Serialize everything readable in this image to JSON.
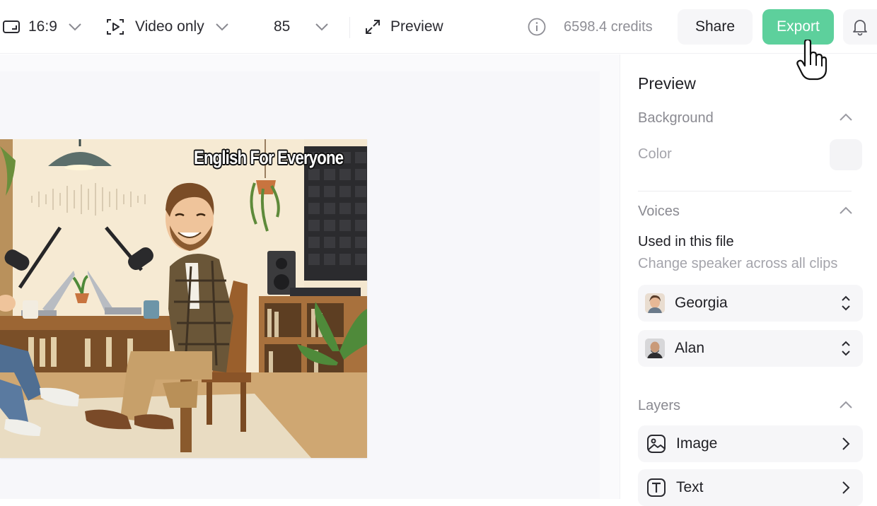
{
  "toolbar": {
    "aspect_ratio": "16:9",
    "media_mode": "Video only",
    "zoom": "85",
    "preview_label": "Preview",
    "credits": "6598.4 credits",
    "share_label": "Share",
    "export_label": "Export"
  },
  "video": {
    "title_overlay": "English For Everyone"
  },
  "panel": {
    "title": "Preview",
    "background": {
      "heading": "Background",
      "color_label": "Color"
    },
    "voices": {
      "heading": "Voices",
      "used_label": "Used in this file",
      "used_sub": "Change speaker across all clips",
      "speakers": [
        "Georgia",
        "Alan"
      ]
    },
    "layers": {
      "heading": "Layers",
      "items": [
        "Image",
        "Text"
      ]
    }
  },
  "colors": {
    "accent": "#5dd09c",
    "muted_text": "#8a8a91"
  },
  "icons": [
    "aspect-ratio-icon",
    "chevron-down-icon",
    "video-mode-icon",
    "expand-icon",
    "info-icon",
    "bell-icon",
    "hand-cursor-icon",
    "chevron-up-icon",
    "up-down-icon",
    "image-layer-icon",
    "text-layer-icon",
    "chevron-right-icon"
  ]
}
